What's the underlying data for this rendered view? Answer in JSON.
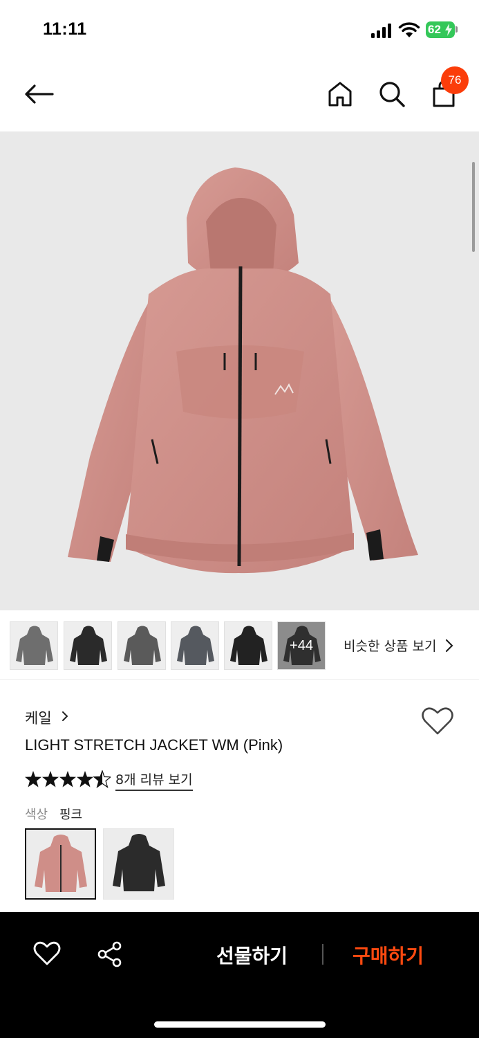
{
  "status_bar": {
    "time": "11:11",
    "battery": "62",
    "icons": [
      "signal-icon",
      "wifi-icon",
      "battery-icon"
    ]
  },
  "header": {
    "icons": [
      "back-arrow-icon",
      "home-icon",
      "search-icon",
      "shopping-bag-icon"
    ],
    "cart_count": "76"
  },
  "product_image": {
    "alt": "Pink hooded stretch jacket",
    "jacket_color": "#cf8e88",
    "background": "#e9e9e9"
  },
  "thumbnails": {
    "items": [
      {
        "color": "#6e6e6e"
      },
      {
        "color": "#2a2a2a"
      },
      {
        "color": "#5a5a5a"
      },
      {
        "color": "#55595f"
      },
      {
        "color": "#222222"
      },
      {
        "color": "#1f1f1f"
      }
    ],
    "more_label": "+44",
    "similar_label": "비슷한 상품 보기"
  },
  "product": {
    "brand": "케일",
    "name": "LIGHT STRETCH JACKET WM (Pink)",
    "rating": 4.5,
    "review_link": "8개 리뷰 보기",
    "color_label": "색상",
    "color_value": "핑크",
    "color_options": [
      {
        "name": "pink",
        "color": "#cf8e88",
        "selected": true
      },
      {
        "name": "black",
        "color": "#2b2b2b",
        "selected": false
      }
    ]
  },
  "bottom_bar": {
    "gift_label": "선물하기",
    "buy_label": "구매하기",
    "accent_color": "#ff4a10",
    "icons": [
      "heart-outline-icon",
      "share-icon"
    ]
  }
}
